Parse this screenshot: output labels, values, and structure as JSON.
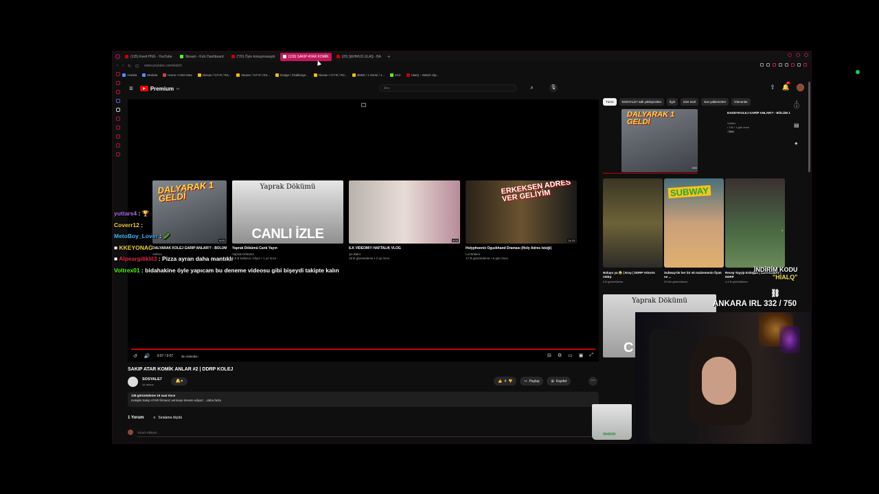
{
  "browser": {
    "tabs": [
      {
        "label": "(135) Keeit PNG - YouTube",
        "color": "#cc0000",
        "active": false
      },
      {
        "label": "Stream - Kick Dashboard",
        "color": "#53fc18",
        "active": false
      },
      {
        "label": "(*20) Öyle konuşmasaydı",
        "color": "#cc0000",
        "active": false
      },
      {
        "label": "(139) SAKIP ATAR KOMİK",
        "color": "#cc0000",
        "active": true
      },
      {
        "label": "(20) ŞEHMUS ULAŞ - BA",
        "color": "#cc0000",
        "active": false
      }
    ],
    "new_tab": "+",
    "url": "www.youtube.com/watch",
    "bookmarks": [
      {
        "label": "Aranka",
        "color": "#5a8dff"
      },
      {
        "label": "Wukela",
        "color": "#5a8dff"
      },
      {
        "label": "Home • HSO Mas",
        "color": "#cc4444"
      },
      {
        "label": "Nissan / GT-R / R3...",
        "color": "#f0c000"
      },
      {
        "label": "Nissan / GT-R / R3...",
        "color": "#f0c000"
      },
      {
        "label": "Dodge / Challenge...",
        "color": "#f0c000"
      },
      {
        "label": "Nissan / GT-R / R3...",
        "color": "#f0c000"
      },
      {
        "label": "BMW / 1 Serisi / 1...",
        "color": "#f0c000"
      },
      {
        "label": "Kick",
        "color": "#53fc18"
      },
      {
        "label": "HiaiQ – Watch clip...",
        "color": "#cc0000"
      }
    ]
  },
  "youtube": {
    "logo_text": "Premium",
    "logo_country": "TR",
    "search_placeholder": "Ara",
    "notification_count": "9+",
    "player": {
      "time": "9:07 / 9:07",
      "chapter": "Bu videoda ›"
    },
    "endscreen": [
      {
        "title": "DALYARAK KOLEJ GARİP ANLAR!? - BÖLÜM 1",
        "channel": "Voltrex",
        "stats": "",
        "duration": "8:03",
        "overlay": "",
        "banner": "",
        "poster": "DALYARAK 1 GELDİ"
      },
      {
        "title": "Yaprak Dökümü Canlı Yayın",
        "channel": "Yaprak Dökümü",
        "stats": "5,6 B kullanıcı izliyor • 1 yıl önce",
        "duration": "",
        "overlay": "CANLI İZLE",
        "banner": "Yaprak Dökümü",
        "poster": ""
      },
      {
        "title": "İLK VİDEOM!!! HAFTALIK VLOG",
        "channel": "Şu Bakır",
        "stats": "18 B görüntüleme • 2 ay önce",
        "duration": "8:03",
        "overlay": "",
        "banner": "",
        "poster": ""
      },
      {
        "title": "Holyphoenix Oguzkhand Draması (Holy Adres İsteği)",
        "channel": "Lol Bülteni",
        "stats": "17 B görüntüleme • 5 gün önce",
        "duration": "11:23",
        "overlay": "",
        "banner": "",
        "poster": "ERKEKSEN ADRES VER GELİYİM"
      }
    ],
    "video": {
      "title": "SAKIP ATAR KOMİK ANLAR #2 | DDRP KOLEJ",
      "channel": "SOSYALE7",
      "subscribers": "44 abone",
      "likes": "4",
      "share_label": "Paylaş",
      "save_label": "Kaydet",
      "desc_stats": "139 görüntüleme  19 saat önce",
      "desc_text": "Kolejde Sakıp ATAR firmasız vermeye devam ediyor! ...daha fazla",
      "comment_count": "1 Yorum",
      "sort_label": "Sıralama ölçütü",
      "add_comment_placeholder": "Yorum ekleyin..."
    },
    "chips": [
      {
        "label": "Tümü",
        "selected": true
      },
      {
        "label": "SOSYALE7 adlı yükleyiciden",
        "selected": false
      },
      {
        "label": "İlgili",
        "selected": false
      },
      {
        "label": "Size özel",
        "selected": false
      },
      {
        "label": "Son yüklenenler",
        "selected": false
      },
      {
        "label": "İzlenenler",
        "selected": false
      }
    ],
    "rec1": {
      "title": "DADDYKOLEJ GARİP ANLAR!? - BÖLÜM 1",
      "channel": "Voltrex",
      "stats": "• 3 B • 1 gün önce",
      "badge": "Yeni",
      "duration": "8:03",
      "thumb_text": "DALYARAK 1 GELDİ"
    },
    "shorts": [
      {
        "title": "Noluyo ya 😂 | Eray | DDRP #shorts #ddrp",
        "views": "6 B görüntüleme",
        "tag": ""
      },
      {
        "title": "Subway'de her bir ek malzemenin fiyatı ne ...",
        "views": "32 Mn görüntüleme",
        "tag": "SUBWAY"
      },
      {
        "title": "Recep Tayyip Erdoğan | UZAYOZBAY | DDRP",
        "views": "4,3 B görüntüleme",
        "tag": ""
      }
    ],
    "rec3": {
      "title": "Yaprak Dökümü Canlı Yayın",
      "banner": "Yaprak Dökümü",
      "overlay": "C"
    }
  },
  "stream": {
    "chat": [
      {
        "user": "yuttars4",
        "color": "#b06ee8",
        "message": "🏆"
      },
      {
        "user": "Coverr12",
        "color": "#f0d23c",
        "message": ""
      },
      {
        "user": "MetoBoy_Lover",
        "color": "#3bbcf7",
        "message": "🥒"
      },
      {
        "user": "KKEYONAG",
        "color": "#f0d23c",
        "message": ""
      },
      {
        "user": "Alpeargiliklil3",
        "color": "#e32a4a",
        "message": "Pizza ayran daha mantıklı"
      },
      {
        "user": "Voltrex01",
        "color": "#53fc18",
        "message": "bidahakine öyle yapıcam bu deneme videosu gibi bişeydi takipte kalın"
      }
    ],
    "discount_line1": "İNDİRİM KODU",
    "discount_code": "\"HIALQ\"",
    "irl_text": "ANKARA IRL 332 / 750",
    "cup_label": "ꝏꝏꝏ"
  },
  "colors": {
    "accent": "#ff0000",
    "active_tab": "#c2185b",
    "kick_green": "#53fc18"
  }
}
